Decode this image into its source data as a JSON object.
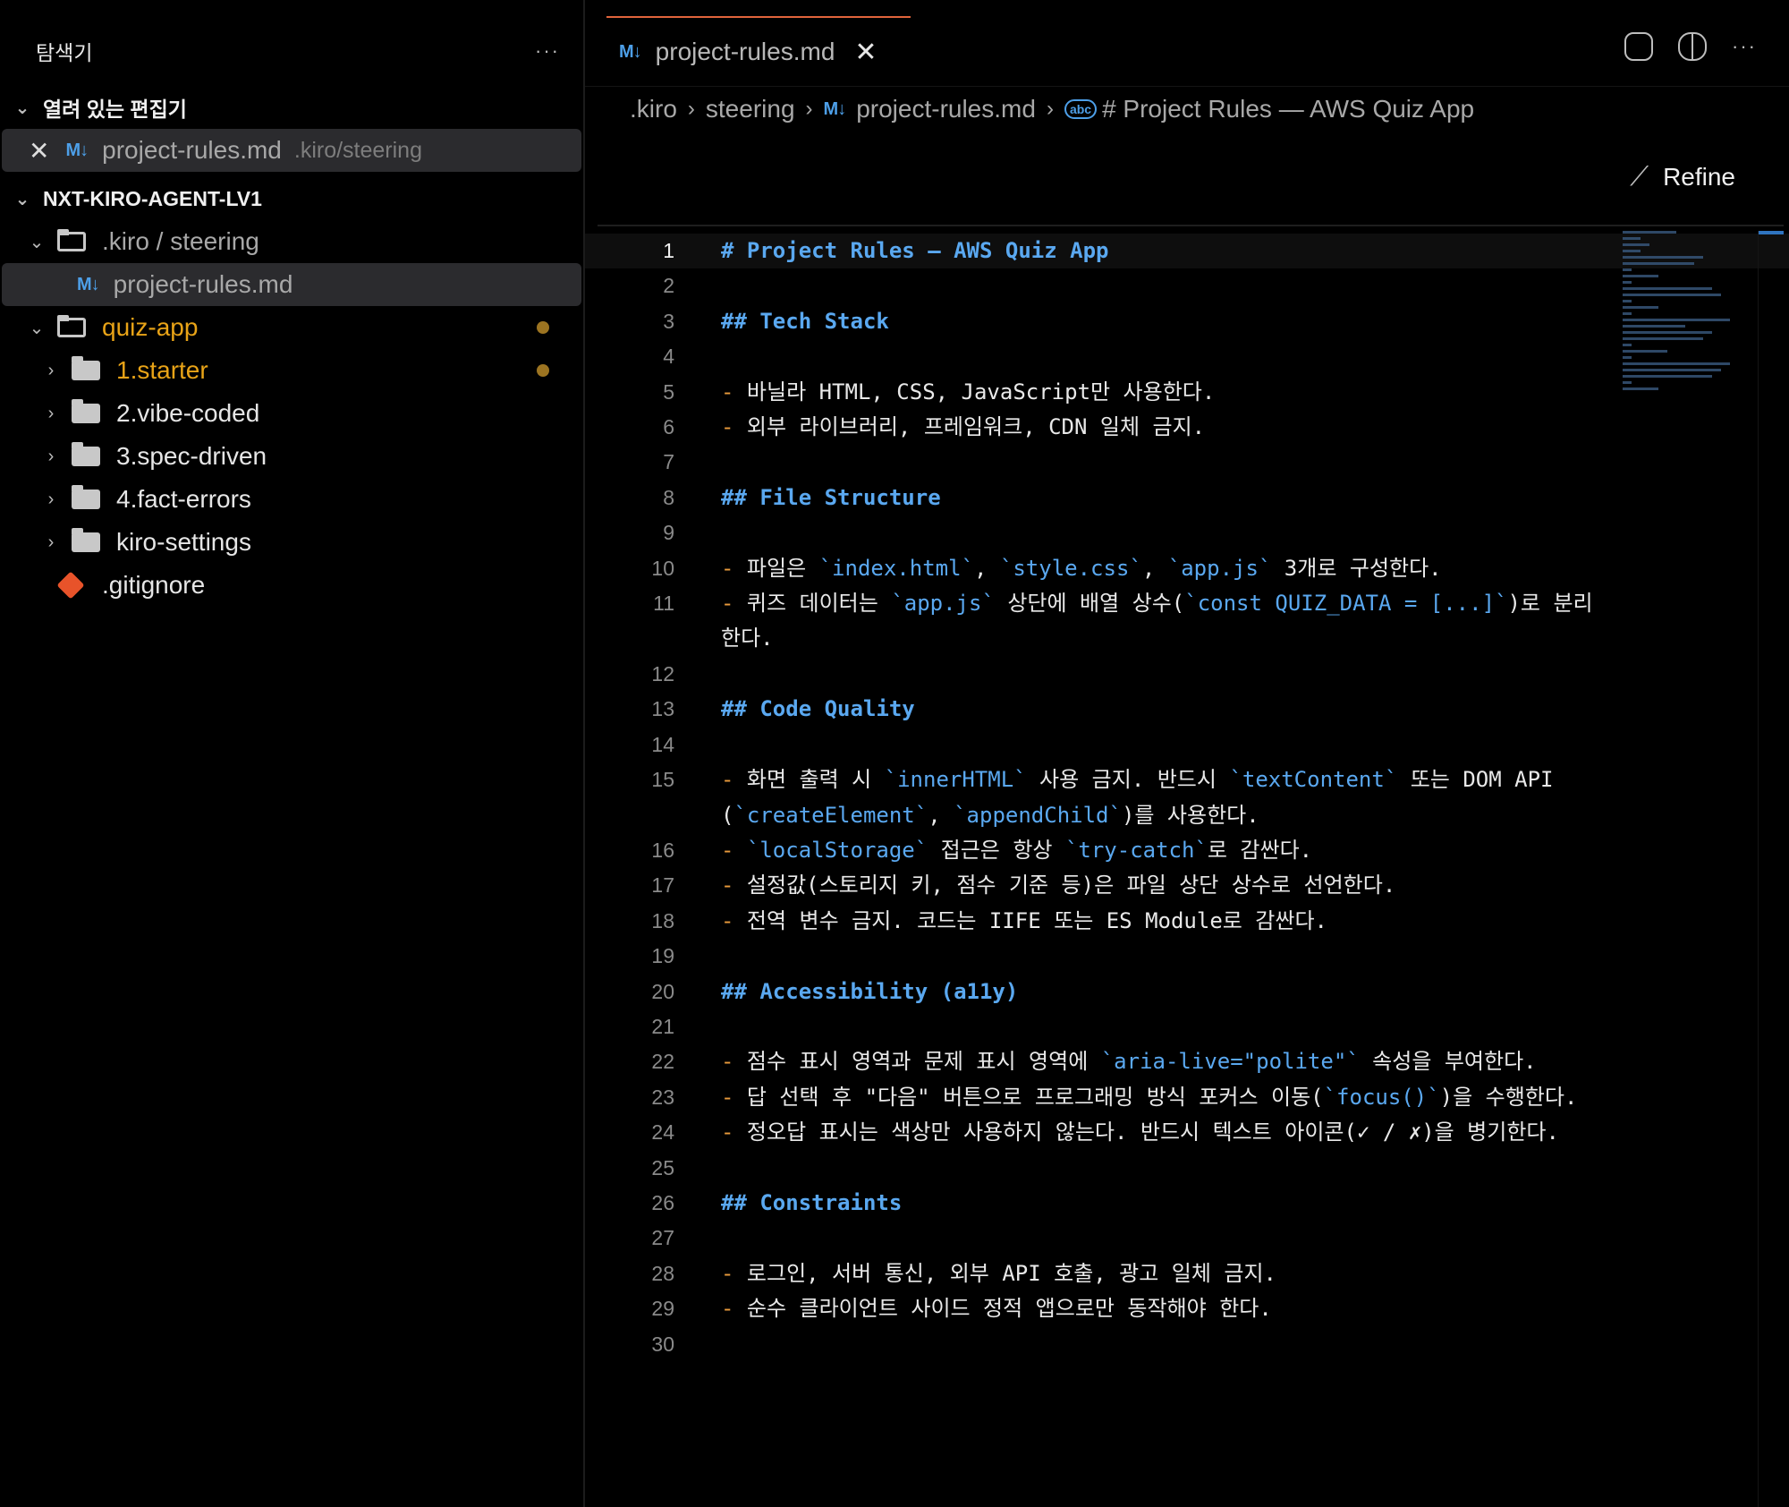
{
  "sidebar": {
    "title": "탐색기",
    "more_label": "···",
    "open_editors": {
      "label": "열려 있는 편집기",
      "items": [
        {
          "name": "project-rules.md",
          "path": ".kiro/steering"
        }
      ]
    },
    "workspace": {
      "label": "NXT-KIRO-AGENT-LV1",
      "tree": [
        {
          "kind": "folder",
          "label": ".kiro / steering",
          "expanded": true,
          "level": 1
        },
        {
          "kind": "file",
          "label": "project-rules.md",
          "level": 2,
          "selected": true
        },
        {
          "kind": "folder",
          "label": "quiz-app",
          "expanded": true,
          "level": 1,
          "modified": true
        },
        {
          "kind": "folder",
          "label": "1.starter",
          "level": 2,
          "modified": true
        },
        {
          "kind": "folder",
          "label": "2.vibe-coded",
          "level": 2
        },
        {
          "kind": "folder",
          "label": "3.spec-driven",
          "level": 2
        },
        {
          "kind": "folder",
          "label": "4.fact-errors",
          "level": 2
        },
        {
          "kind": "folder",
          "label": "kiro-settings",
          "level": 2
        },
        {
          "kind": "file",
          "label": ".gitignore",
          "level": 1
        }
      ]
    }
  },
  "editor": {
    "tab": {
      "label": "project-rules.md",
      "icon": "markdown-icon"
    },
    "breadcrumb": [
      ".kiro",
      "steering",
      "project-rules.md",
      "# Project Rules — AWS Quiz App"
    ],
    "refine_label": "Refine",
    "lines": [
      {
        "n": "1",
        "type": "h",
        "text": "# Project Rules — AWS Quiz App"
      },
      {
        "n": "2",
        "type": "blank",
        "text": ""
      },
      {
        "n": "3",
        "type": "h",
        "text": "## Tech Stack"
      },
      {
        "n": "4",
        "type": "blank",
        "text": ""
      },
      {
        "n": "5",
        "type": "li",
        "segs": [
          [
            "t",
            "바닐라 HTML, CSS, JavaScript만 사용한다."
          ]
        ]
      },
      {
        "n": "6",
        "type": "li",
        "segs": [
          [
            "t",
            "외부 라이브러리, 프레임워크, CDN 일체 금지."
          ]
        ]
      },
      {
        "n": "7",
        "type": "blank",
        "text": ""
      },
      {
        "n": "8",
        "type": "h",
        "text": "## File Structure"
      },
      {
        "n": "9",
        "type": "blank",
        "text": ""
      },
      {
        "n": "10",
        "type": "li",
        "segs": [
          [
            "t",
            "파일은 "
          ],
          [
            "c",
            "`index.html`"
          ],
          [
            "t",
            ", "
          ],
          [
            "c",
            "`style.css`"
          ],
          [
            "t",
            ", "
          ],
          [
            "c",
            "`app.js`"
          ],
          [
            "t",
            " 3개로 구성한다."
          ]
        ]
      },
      {
        "n": "11",
        "type": "li",
        "segs": [
          [
            "t",
            "퀴즈 데이터는 "
          ],
          [
            "c",
            "`app.js`"
          ],
          [
            "t",
            " 상단에 배열 상수("
          ],
          [
            "c",
            "`const QUIZ_DATA = [...]`"
          ],
          [
            "t",
            ")로 분리한다."
          ]
        ]
      },
      {
        "n": "12",
        "type": "blank",
        "text": ""
      },
      {
        "n": "13",
        "type": "h",
        "text": "## Code Quality"
      },
      {
        "n": "14",
        "type": "blank",
        "text": ""
      },
      {
        "n": "15",
        "type": "li",
        "segs": [
          [
            "t",
            "화면 출력 시 "
          ],
          [
            "c",
            "`innerHTML`"
          ],
          [
            "t",
            " 사용 금지. 반드시 "
          ],
          [
            "c",
            "`textContent`"
          ],
          [
            "t",
            " 또는 DOM API ("
          ],
          [
            "c",
            "`createElement`"
          ],
          [
            "t",
            ", "
          ],
          [
            "c",
            "`appendChild`"
          ],
          [
            "t",
            ")를 사용한다."
          ]
        ]
      },
      {
        "n": "16",
        "type": "li",
        "segs": [
          [
            "c",
            "`localStorage`"
          ],
          [
            "t",
            " 접근은 항상 "
          ],
          [
            "c",
            "`try-catch`"
          ],
          [
            "t",
            "로 감싼다."
          ]
        ]
      },
      {
        "n": "17",
        "type": "li",
        "segs": [
          [
            "t",
            "설정값(스토리지 키, 점수 기준 등)은 파일 상단 상수로 선언한다."
          ]
        ]
      },
      {
        "n": "18",
        "type": "li",
        "segs": [
          [
            "t",
            "전역 변수 금지. 코드는 IIFE 또는 ES Module로 감싼다."
          ]
        ]
      },
      {
        "n": "19",
        "type": "blank",
        "text": ""
      },
      {
        "n": "20",
        "type": "h",
        "text": "## Accessibility (a11y)"
      },
      {
        "n": "21",
        "type": "blank",
        "text": ""
      },
      {
        "n": "22",
        "type": "li",
        "segs": [
          [
            "t",
            "점수 표시 영역과 문제 표시 영역에 "
          ],
          [
            "c",
            "`aria-live=\"polite\"`"
          ],
          [
            "t",
            " 속성을 부여한다."
          ]
        ]
      },
      {
        "n": "23",
        "type": "li",
        "segs": [
          [
            "t",
            "답 선택 후 \"다음\" 버튼으로 프로그래밍 방식 포커스 이동("
          ],
          [
            "c",
            "`focus()`"
          ],
          [
            "t",
            ")을 수행한다."
          ]
        ]
      },
      {
        "n": "24",
        "type": "li",
        "segs": [
          [
            "t",
            "정오답 표시는 색상만 사용하지 않는다. 반드시 텍스트 아이콘(✓ / ✗)을 병기한다."
          ]
        ]
      },
      {
        "n": "25",
        "type": "blank",
        "text": ""
      },
      {
        "n": "26",
        "type": "h",
        "text": "## Constraints"
      },
      {
        "n": "27",
        "type": "blank",
        "text": ""
      },
      {
        "n": "28",
        "type": "li",
        "segs": [
          [
            "t",
            "로그인, 서버 통신, 외부 API 호출, 광고 일체 금지."
          ]
        ]
      },
      {
        "n": "29",
        "type": "li",
        "segs": [
          [
            "t",
            "순수 클라이언트 사이드 정적 앱으로만 동작해야 한다."
          ]
        ]
      },
      {
        "n": "30",
        "type": "blank",
        "text": ""
      }
    ]
  },
  "colors": {
    "accent_tab": "#e0643b",
    "heading": "#5aa8f0",
    "bullet": "#e89a3c",
    "modified": "#e8a317"
  }
}
